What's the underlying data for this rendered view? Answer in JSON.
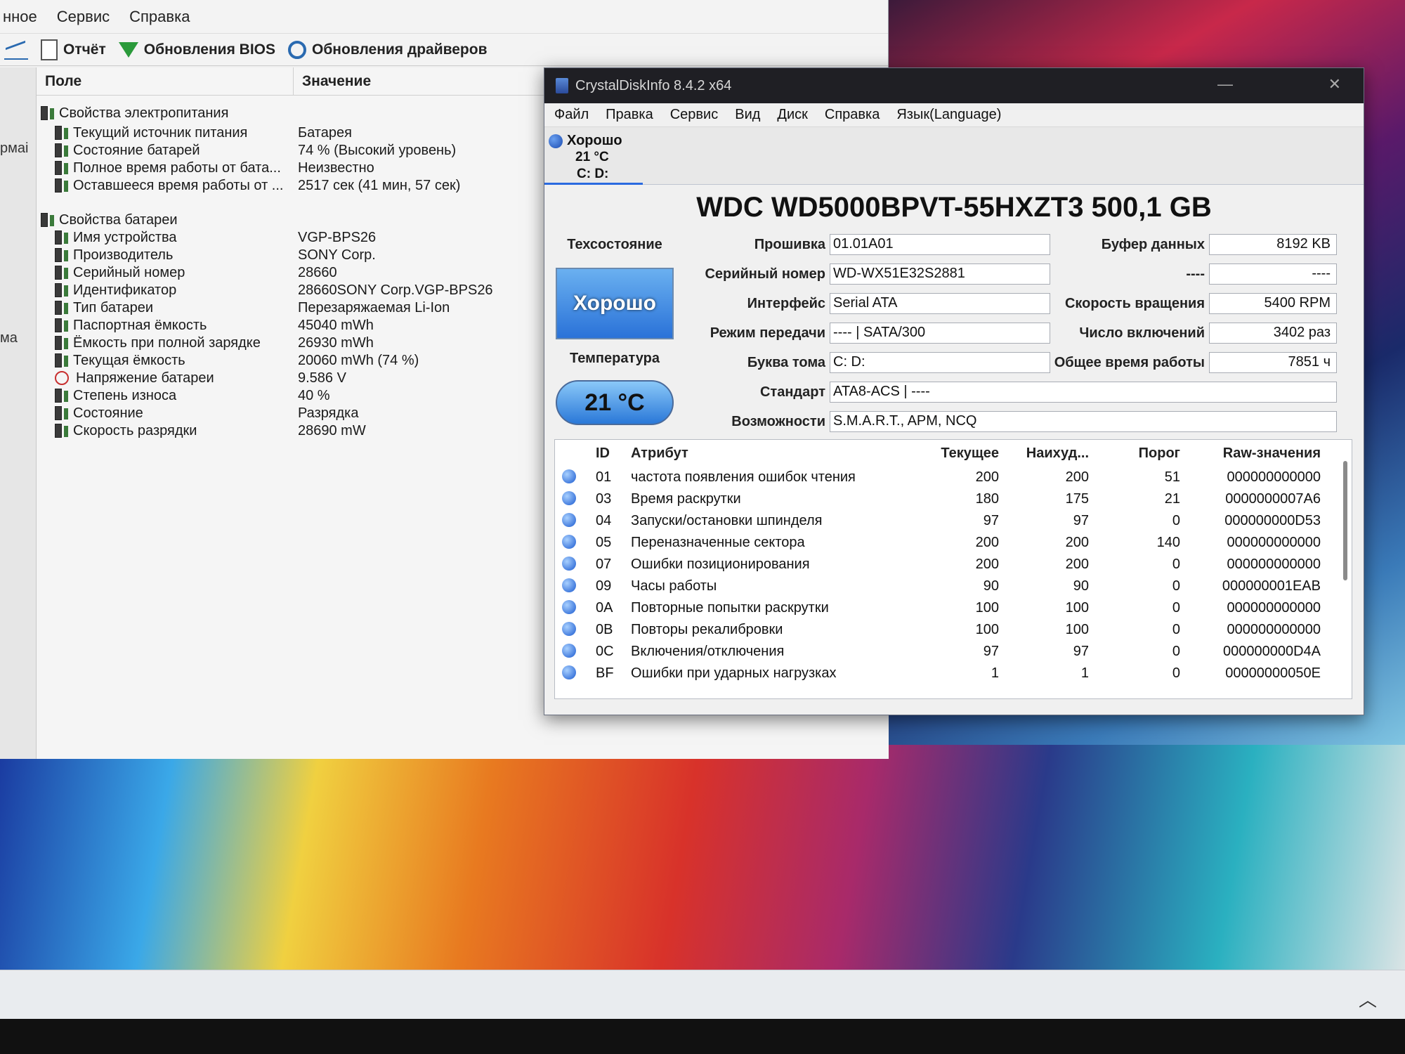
{
  "aida": {
    "menu": [
      "нное",
      "Сервис",
      "Справка"
    ],
    "toolbar": {
      "report": "Отчёт",
      "bios": "Обновления BIOS",
      "drivers": "Обновления драйверов"
    },
    "left_strip": [
      "рмаі",
      "ма"
    ],
    "columns": {
      "field": "Поле",
      "value": "Значение"
    },
    "rows": [
      {
        "field": "Свойства электропитания",
        "value": "",
        "group": true
      },
      {
        "field": "Текущий источник питания",
        "value": "Батарея"
      },
      {
        "field": "Состояние батарей",
        "value": "74 % (Высокий уровень)"
      },
      {
        "field": "Полное время работы от бата...",
        "value": "Неизвестно"
      },
      {
        "field": "Оставшееся время работы от ...",
        "value": "2517 сек (41 мин, 57 сек)"
      },
      {
        "field": "Свойства батареи",
        "value": "",
        "group": true
      },
      {
        "field": "Имя устройства",
        "value": "VGP-BPS26"
      },
      {
        "field": "Производитель",
        "value": "SONY Corp."
      },
      {
        "field": "Серийный номер",
        "value": "28660"
      },
      {
        "field": "Идентификатор",
        "value": "28660SONY Corp.VGP-BPS26"
      },
      {
        "field": "Тип батареи",
        "value": "Перезаряжаемая Li-Ion"
      },
      {
        "field": "Паспортная ёмкость",
        "value": "45040 mWh"
      },
      {
        "field": "Ёмкость при полной зарядке",
        "value": "26930 mWh"
      },
      {
        "field": "Текущая ёмкость",
        "value": "20060 mWh  (74 %)"
      },
      {
        "field": "Напряжение батареи",
        "value": "9.586 V"
      },
      {
        "field": "Степень износа",
        "value": "40 %"
      },
      {
        "field": "Состояние",
        "value": "Разрядка"
      },
      {
        "field": "Скорость разрядки",
        "value": "28690 mW"
      }
    ]
  },
  "cdi": {
    "title": "CrystalDiskInfo 8.4.2 x64",
    "menu": [
      "Файл",
      "Правка",
      "Сервис",
      "Вид",
      "Диск",
      "Справка",
      "Язык(Language)"
    ],
    "disk_tab": {
      "status": "Хорошо",
      "temp": "21 °C",
      "volumes": "C: D:"
    },
    "model": "WDC WD5000BPVT-55HXZT3 500,1 GB",
    "health_label": "Техсостояние",
    "health_value": "Хорошо",
    "temp_label": "Температура",
    "temp_value": "21 °C",
    "info": {
      "firmware_label": "Прошивка",
      "firmware": "01.01A01",
      "serial_label": "Серийный номер",
      "serial": "WD-WX51E32S2881",
      "interface_label": "Интерфейс",
      "interface": "Serial ATA",
      "transfer_label": "Режим передачи",
      "transfer": "---- | SATA/300",
      "volume_label": "Буква тома",
      "volume": "C: D:",
      "standard_label": "Стандарт",
      "standard": "ATA8-ACS | ----",
      "features_label": "Возможности",
      "features": "S.M.A.R.T., APM, NCQ",
      "buffer_label": "Буфер данных",
      "buffer": "8192 KB",
      "blank_label": "----",
      "blank": "----",
      "rotation_label": "Скорость вращения",
      "rotation": "5400 RPM",
      "power_count_label": "Число включений",
      "power_count": "3402 раз",
      "power_hours_label": "Общее время работы",
      "power_hours": "7851 ч"
    },
    "smart_columns": {
      "id": "ID",
      "attr": "Атрибут",
      "cur": "Текущее",
      "worst": "Наихуд...",
      "thr": "Порог",
      "raw": "Raw-значения"
    },
    "smart": [
      {
        "id": "01",
        "attr": "частота появления ошибок чтения",
        "cur": "200",
        "worst": "200",
        "thr": "51",
        "raw": "000000000000"
      },
      {
        "id": "03",
        "attr": "Время раскрутки",
        "cur": "180",
        "worst": "175",
        "thr": "21",
        "raw": "0000000007A6"
      },
      {
        "id": "04",
        "attr": "Запуски/остановки шпинделя",
        "cur": "97",
        "worst": "97",
        "thr": "0",
        "raw": "000000000D53"
      },
      {
        "id": "05",
        "attr": "Переназначенные сектора",
        "cur": "200",
        "worst": "200",
        "thr": "140",
        "raw": "000000000000"
      },
      {
        "id": "07",
        "attr": "Ошибки позиционирования",
        "cur": "200",
        "worst": "200",
        "thr": "0",
        "raw": "000000000000"
      },
      {
        "id": "09",
        "attr": "Часы работы",
        "cur": "90",
        "worst": "90",
        "thr": "0",
        "raw": "000000001EAB"
      },
      {
        "id": "0A",
        "attr": "Повторные попытки раскрутки",
        "cur": "100",
        "worst": "100",
        "thr": "0",
        "raw": "000000000000"
      },
      {
        "id": "0B",
        "attr": "Повторы рекалибровки",
        "cur": "100",
        "worst": "100",
        "thr": "0",
        "raw": "000000000000"
      },
      {
        "id": "0C",
        "attr": "Включения/отключения",
        "cur": "97",
        "worst": "97",
        "thr": "0",
        "raw": "000000000D4A"
      },
      {
        "id": "BF",
        "attr": "Ошибки при ударных нагрузках",
        "cur": "1",
        "worst": "1",
        "thr": "0",
        "raw": "00000000050E"
      }
    ]
  }
}
